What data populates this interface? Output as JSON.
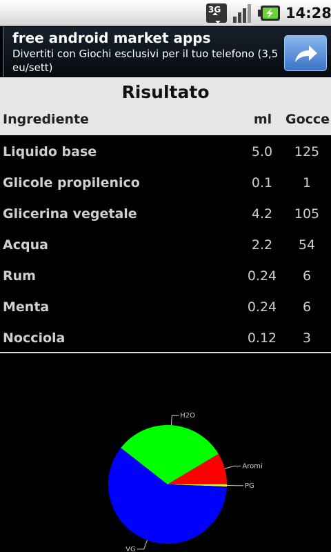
{
  "status_bar": {
    "time": "14:28",
    "network_icon": "3g-icon",
    "signal_icon": "signal-bars-icon",
    "battery_icon": "battery-charging-icon"
  },
  "ad": {
    "title": "free android market apps",
    "description": "Divertiti con Giochi esclusivi per il tuo telefono (3,5 eu/sett)",
    "button_icon": "share-arrow-icon"
  },
  "result": {
    "title": "Risultato",
    "headers": {
      "ingredient": "Ingrediente",
      "ml": "ml",
      "drops": "Gocce"
    },
    "rows": [
      {
        "name": "Liquido base",
        "ml": "5.0",
        "drops": "125"
      },
      {
        "name": "Glicole propilenico",
        "ml": "0.1",
        "drops": "1"
      },
      {
        "name": "Glicerina vegetale",
        "ml": "4.2",
        "drops": "105"
      },
      {
        "name": "Acqua",
        "ml": "2.2",
        "drops": "54"
      },
      {
        "name": "Rum",
        "ml": "0.24",
        "drops": "6"
      },
      {
        "name": "Menta",
        "ml": "0.24",
        "drops": "6"
      },
      {
        "name": "Nocciola",
        "ml": "0.12",
        "drops": "3"
      }
    ]
  },
  "chart_data": {
    "type": "pie",
    "start_angle_deg": 0,
    "slices": [
      {
        "label": "PG",
        "value": 1,
        "color": "#ffff00"
      },
      {
        "label": "VG",
        "value": 105,
        "color": "#0000ff"
      },
      {
        "label": "H2O",
        "value": 54,
        "color": "#00ff00"
      },
      {
        "label": "Aromi",
        "value": 15,
        "color": "#ff0000"
      }
    ]
  },
  "colors": {
    "background": "#000000",
    "header_bg": "#e6e6e6",
    "ad_button": "#4a84d4"
  }
}
